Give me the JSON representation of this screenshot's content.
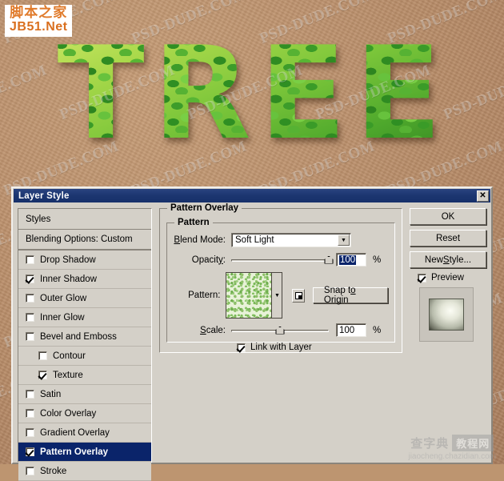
{
  "artwork": {
    "headline_text": "TREE",
    "background_color": "#bd9570",
    "watermark_text": "PSD-DUDE.COM",
    "logo": {
      "cn": "脚本之家",
      "en": "JB51.Net"
    },
    "footer_watermark": {
      "brand_cn": "查字典",
      "brand_tag": "教程网",
      "url": "jiaocheng.chazidian.com"
    }
  },
  "dialog": {
    "title": "Layer Style",
    "close_label": "✕",
    "styles_panel": {
      "header": "Styles",
      "blending_options": "Blending Options: Custom",
      "items": [
        {
          "label": "Drop Shadow",
          "checked": false,
          "indent": false,
          "selected": false
        },
        {
          "label": "Inner Shadow",
          "checked": true,
          "indent": false,
          "selected": false
        },
        {
          "label": "Outer Glow",
          "checked": false,
          "indent": false,
          "selected": false
        },
        {
          "label": "Inner Glow",
          "checked": false,
          "indent": false,
          "selected": false
        },
        {
          "label": "Bevel and Emboss",
          "checked": false,
          "indent": false,
          "selected": false
        },
        {
          "label": "Contour",
          "checked": false,
          "indent": true,
          "selected": false
        },
        {
          "label": "Texture",
          "checked": true,
          "indent": true,
          "selected": false
        },
        {
          "label": "Satin",
          "checked": false,
          "indent": false,
          "selected": false
        },
        {
          "label": "Color Overlay",
          "checked": false,
          "indent": false,
          "selected": false
        },
        {
          "label": "Gradient Overlay",
          "checked": false,
          "indent": false,
          "selected": false
        },
        {
          "label": "Pattern Overlay",
          "checked": true,
          "indent": false,
          "selected": true
        },
        {
          "label": "Stroke",
          "checked": false,
          "indent": false,
          "selected": false
        }
      ]
    },
    "pattern_overlay": {
      "group_title": "Pattern Overlay",
      "inner_group_title": "Pattern",
      "blend_mode_label": "Blend Mode:",
      "blend_mode_value": "Soft Light",
      "opacity_label": "Opacity:",
      "opacity_value": "100",
      "opacity_unit": "%",
      "opacity_percent": 100,
      "pattern_label": "Pattern:",
      "snap_to_origin_label": "Snap to Origin",
      "scale_label": "Scale:",
      "scale_value": "100",
      "scale_unit": "%",
      "scale_percent": 50,
      "link_with_layer_label": "Link with Layer",
      "link_with_layer_checked": true
    },
    "buttons": {
      "ok": "OK",
      "reset": "Reset",
      "new_style": "New Style...",
      "preview_label": "Preview",
      "preview_checked": true
    }
  }
}
